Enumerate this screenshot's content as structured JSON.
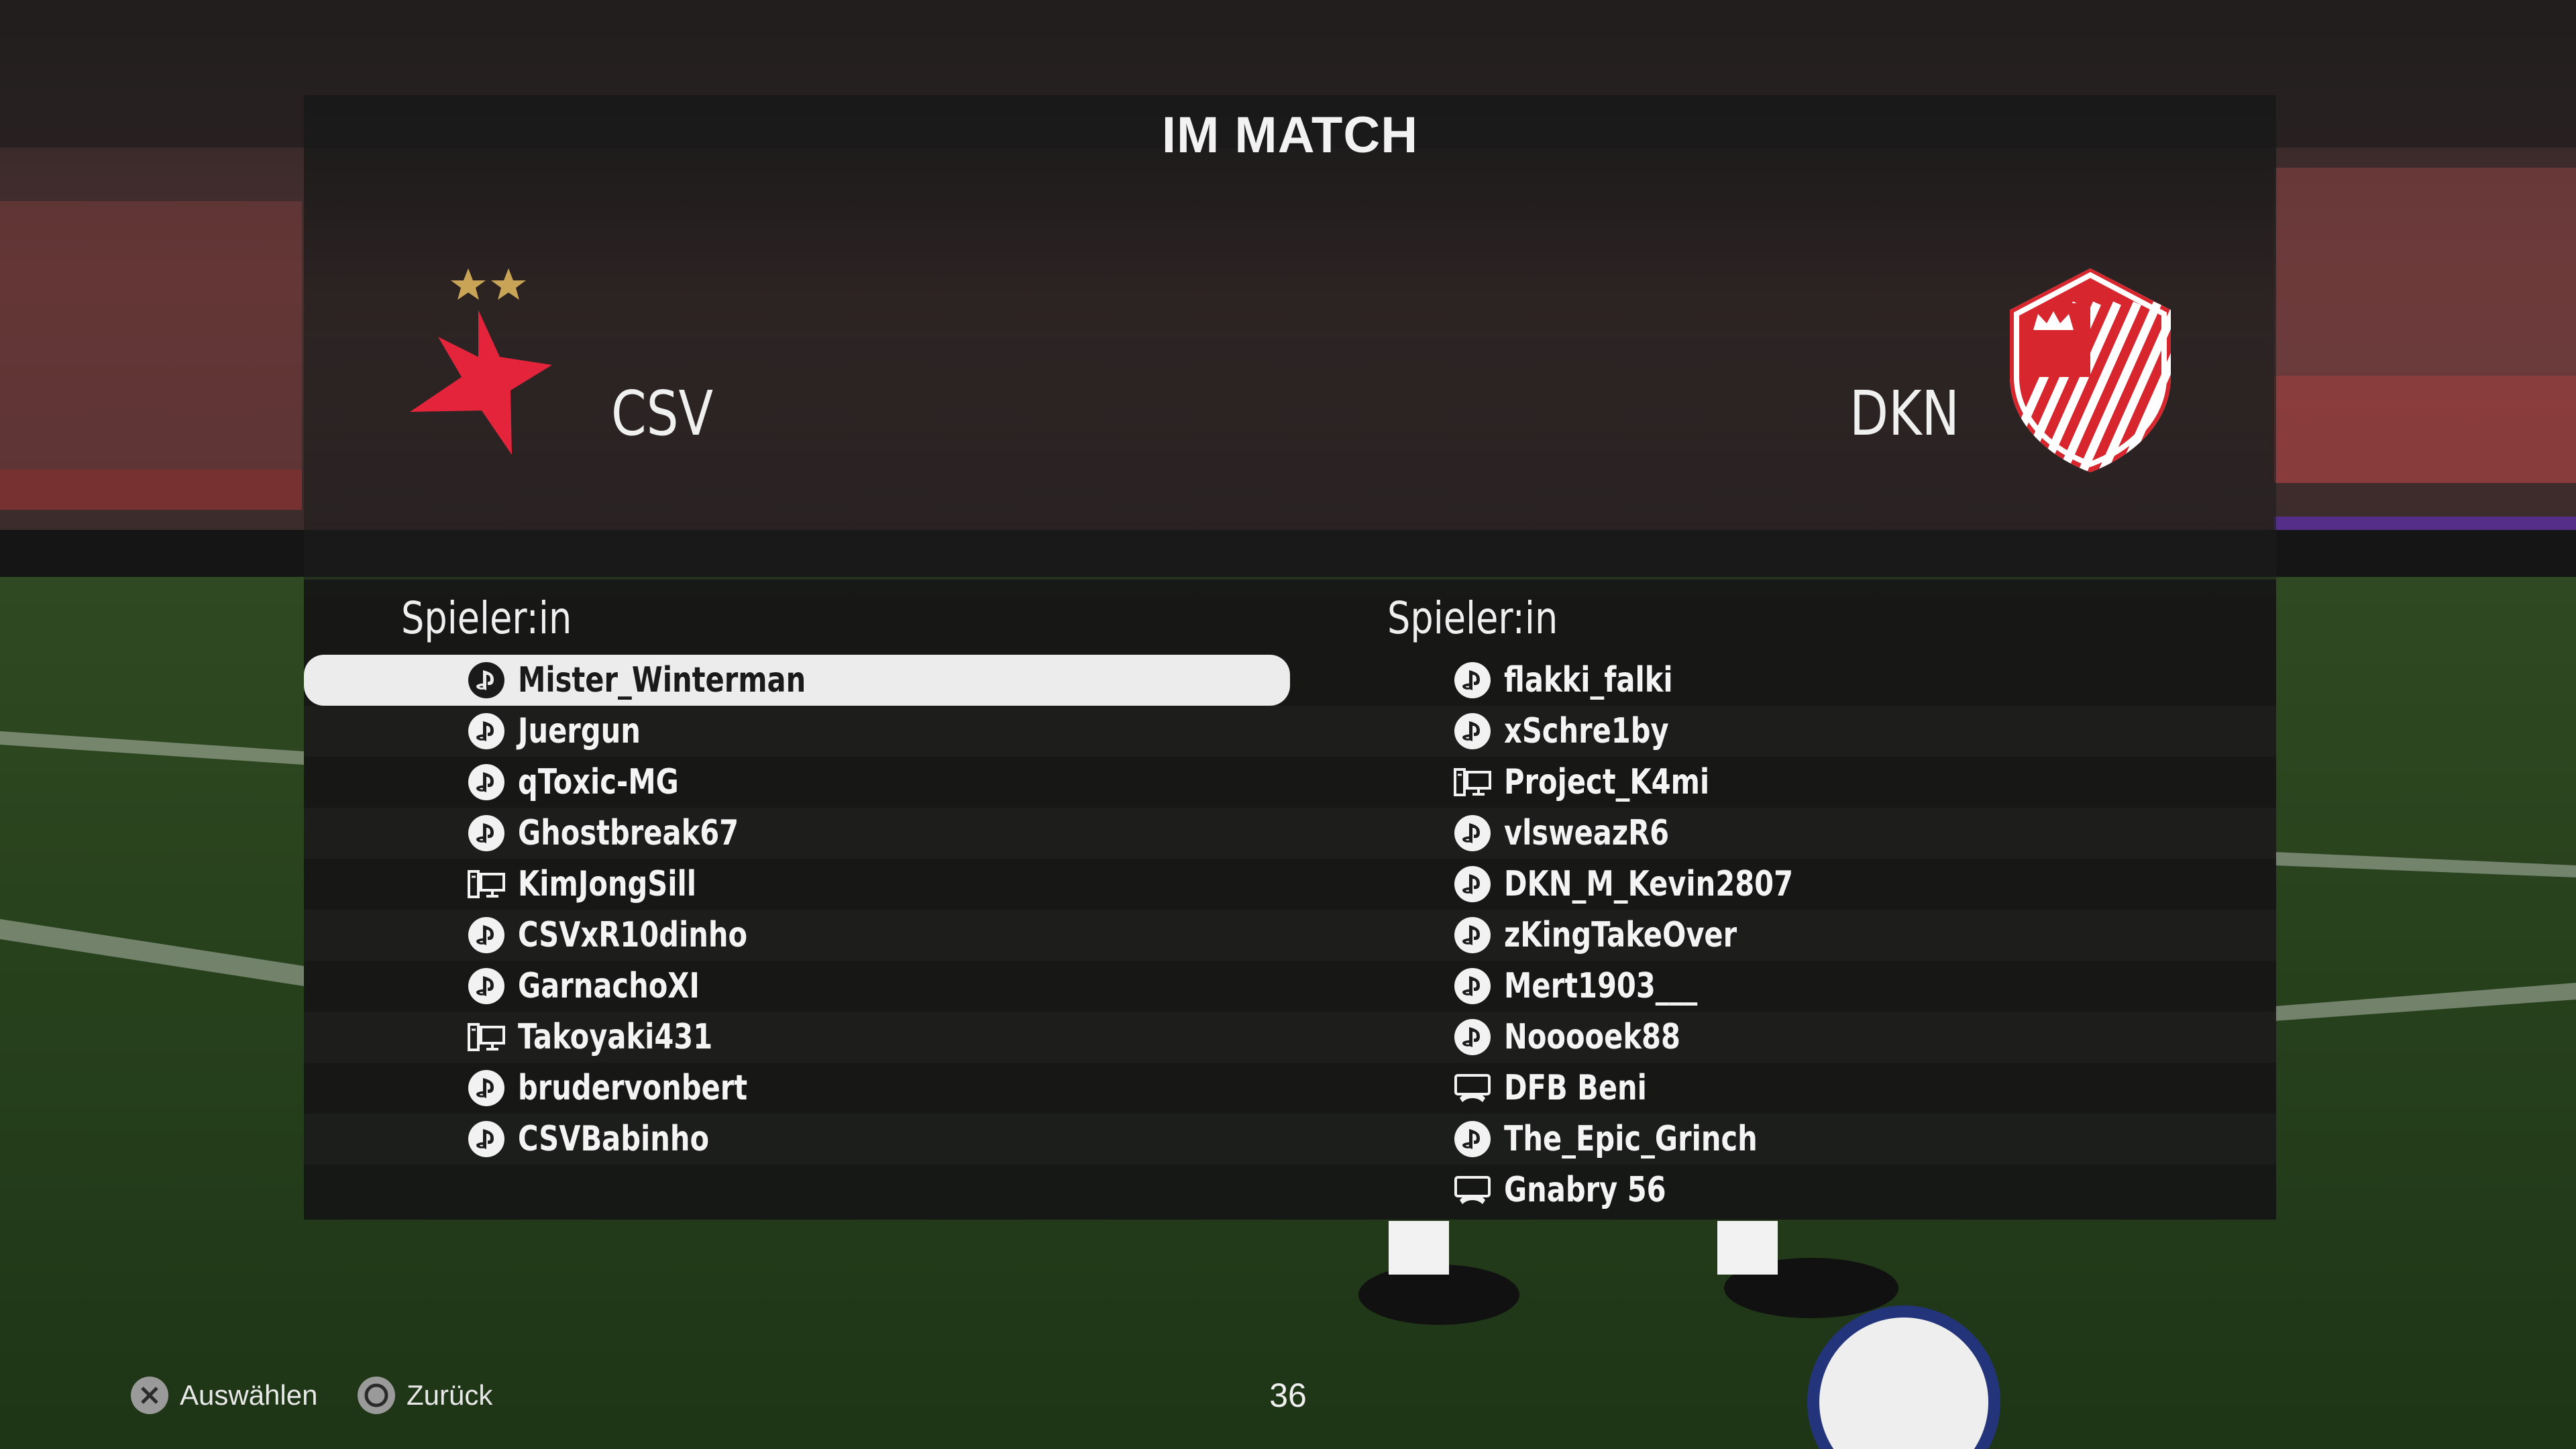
{
  "header": {
    "title": "IM MATCH"
  },
  "teams": {
    "home": {
      "abbr": "CSV",
      "column_header": "Spieler:in",
      "primary_color": "#e3243b"
    },
    "away": {
      "abbr": "DKN",
      "column_header": "Spieler:in",
      "primary_color": "#d8262f"
    }
  },
  "home_players": [
    {
      "name": "Mister_Winterman",
      "platform": "playstation-icon",
      "selected": true
    },
    {
      "name": "Juergun",
      "platform": "playstation-icon"
    },
    {
      "name": "qToxic-MG",
      "platform": "playstation-icon"
    },
    {
      "name": "Ghostbreak67",
      "platform": "playstation-icon"
    },
    {
      "name": "KimJongSill",
      "platform": "pc-icon"
    },
    {
      "name": "CSVxR10dinho",
      "platform": "playstation-icon"
    },
    {
      "name": "GarnachoXI",
      "platform": "playstation-icon"
    },
    {
      "name": "Takoyaki431",
      "platform": "pc-icon"
    },
    {
      "name": "brudervonbert",
      "platform": "playstation-icon"
    },
    {
      "name": "CSVBabinho",
      "platform": "playstation-icon"
    }
  ],
  "away_players": [
    {
      "name": "flakki_falki",
      "platform": "playstation-icon"
    },
    {
      "name": "xSchre1by",
      "platform": "playstation-icon"
    },
    {
      "name": "Project_K4mi",
      "platform": "pc-icon"
    },
    {
      "name": "vlsweazR6",
      "platform": "playstation-icon"
    },
    {
      "name": "DKN_M_Kevin2807",
      "platform": "playstation-icon"
    },
    {
      "name": "zKingTakeOver",
      "platform": "playstation-icon"
    },
    {
      "name": "Mert1903___",
      "platform": "playstation-icon"
    },
    {
      "name": "Nooooek88",
      "platform": "playstation-icon"
    },
    {
      "name": "DFB Beni",
      "platform": "xbox-icon"
    },
    {
      "name": "The_Epic_Grinch",
      "platform": "playstation-icon"
    },
    {
      "name": "Gnabry 56",
      "platform": "xbox-icon"
    }
  ],
  "footer": {
    "select_label": "Auswählen",
    "select_icon": "cross-button-icon",
    "back_label": "Zurück",
    "back_icon": "circle-button-icon",
    "counter": "36"
  }
}
